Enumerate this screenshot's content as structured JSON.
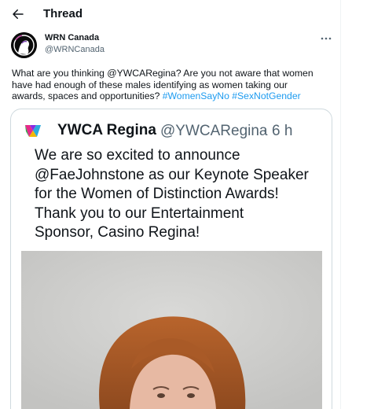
{
  "header": {
    "title": "Thread"
  },
  "author": {
    "name": "WRN Canada",
    "handle": "@WRNCanada"
  },
  "post": {
    "line1": "What are you thinking @YWCARegina? Are you not aware that women",
    "line2": "have had enough of these males identifying as women taking our",
    "line3_text": "awards, spaces and opportunities? ",
    "hashtag1": "#WomenSayNo",
    "hashtag2": "#SexNotGender"
  },
  "quote": {
    "name": "YWCA Regina",
    "handle": "@YWCARegina",
    "separator": "·",
    "time": "6 h",
    "lines": [
      "We are so excited to announce",
      "@FaeJohnstone as our Keynote Speaker",
      "for the Women of Distinction Awards!",
      "Thank you to our Entertainment",
      "Sponsor, Casino Regina!"
    ]
  },
  "colors": {
    "link": "#1d9bf0",
    "secondary_text": "#536471",
    "border": "#cfd9de"
  },
  "icons": {
    "back": "arrow-left-icon",
    "more": "more-horizontal-icon",
    "logo": "ywca-logo-icon"
  }
}
